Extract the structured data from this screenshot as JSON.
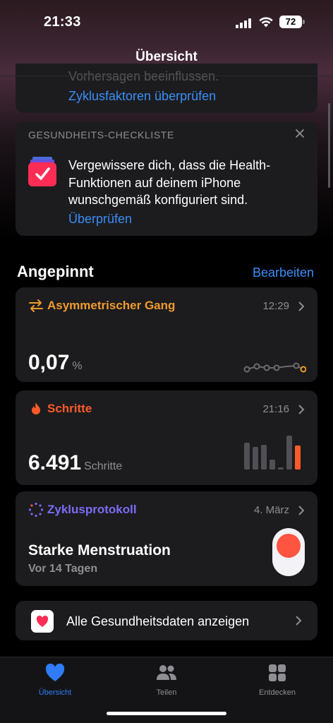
{
  "status": {
    "time": "21:33",
    "battery": "72"
  },
  "nav": {
    "title": "Übersicht"
  },
  "top_card": {
    "cutoff_text": "Vorhersagen beeinflussen.",
    "link": "Zyklusfaktoren überprüfen"
  },
  "checklist": {
    "title": "GESUNDHEITS-CHECKLISTE",
    "text": "Vergewissere dich, dass die Health-Funktionen auf deinem iPhone wunschgemäß konfiguriert sind.",
    "link": "Überprüfen"
  },
  "pinned": {
    "title": "Angepinnt",
    "edit": "Bearbeiten",
    "gang": {
      "label": "Asymmetrischer Gang",
      "time": "12:29",
      "value": "0,07",
      "unit": "%"
    },
    "schritte": {
      "label": "Schritte",
      "time": "21:16",
      "value": "6.491",
      "unit": "Schritte"
    },
    "zyklus": {
      "label": "Zyklusprotokoll",
      "time": "4. März",
      "title": "Starke Menstruation",
      "sub": "Vor 14 Tagen"
    }
  },
  "all_data": {
    "label": "Alle Gesundheitsdaten anzeigen"
  },
  "tabs": [
    {
      "label": "Übersicht"
    },
    {
      "label": "Teilen"
    },
    {
      "label": "Entdecken"
    }
  ],
  "colors": {
    "accent": "#3a8ef6",
    "gang": "#f09a2d",
    "steps": "#ff5a2a",
    "cycle": "#7b6cf6"
  }
}
